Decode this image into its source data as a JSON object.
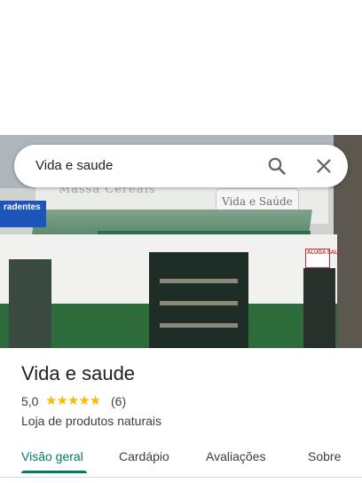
{
  "search": {
    "query": "Vida e saude"
  },
  "photo": {
    "sign_left_text": "radentes",
    "sign_faded_text": "Massa Cereais",
    "shop_sign_text": "Vida e Saúde",
    "rent_sign_text": "ALUGA SALA"
  },
  "place": {
    "name": "Vida e saude",
    "rating": "5,0",
    "stars": "★★★★★",
    "review_count": "(6)",
    "category": "Loja de produtos naturais"
  },
  "tabs": [
    {
      "label": "Visão geral",
      "active": true
    },
    {
      "label": "Cardápio",
      "active": false
    },
    {
      "label": "Avaliações",
      "active": false
    },
    {
      "label": "Sobre",
      "active": false
    }
  ],
  "colors": {
    "accent": "#00796b",
    "star": "#fbbc04",
    "text_primary": "#202124",
    "text_secondary": "#3c4043"
  },
  "icons": {
    "search": "search-icon",
    "close": "close-icon"
  }
}
